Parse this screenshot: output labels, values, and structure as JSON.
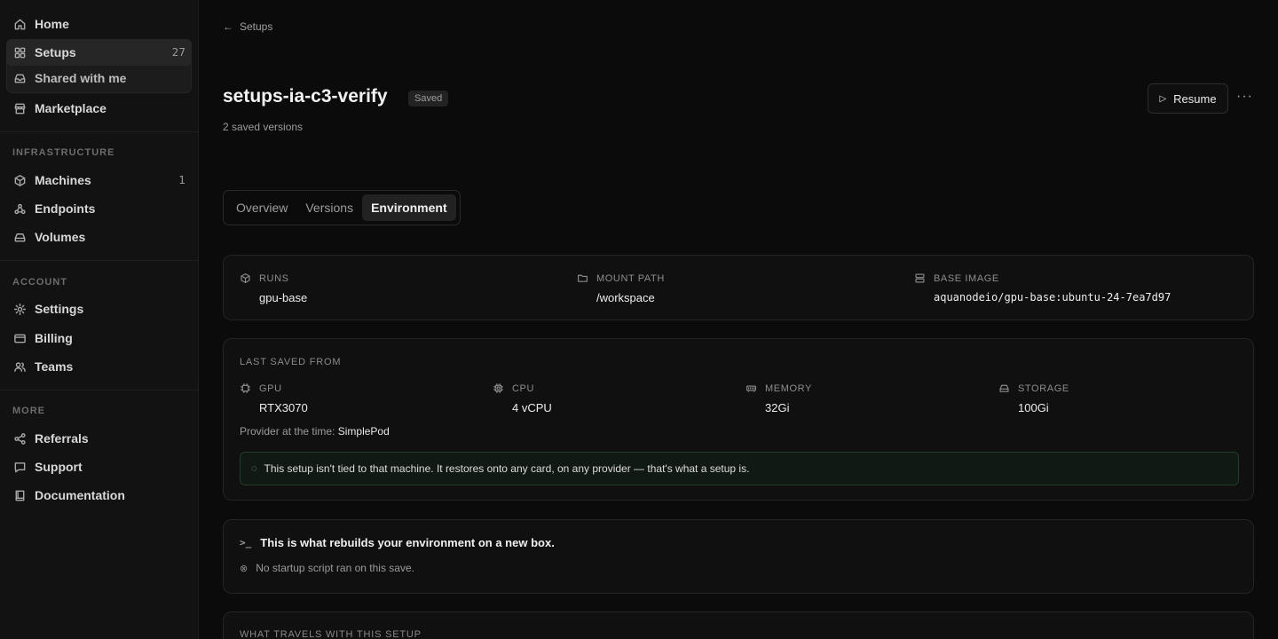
{
  "sidebar": {
    "home": "Home",
    "setups": "Setups",
    "setups_count": "27",
    "shared": "Shared with me",
    "marketplace": "Marketplace",
    "infra_header": "INFRASTRUCTURE",
    "machines": "Machines",
    "machines_count": "1",
    "endpoints": "Endpoints",
    "volumes": "Volumes",
    "account_header": "ACCOUNT",
    "settings": "Settings",
    "billing": "Billing",
    "teams": "Teams",
    "more_header": "MORE",
    "referrals": "Referrals",
    "support": "Support",
    "documentation": "Documentation"
  },
  "header": {
    "back_label": "Setups",
    "title": "setups-ia-c3-verify",
    "badge": "Saved",
    "subtitle": "2 saved versions",
    "resume_label": "Resume",
    "more_label": "···"
  },
  "tabs": [
    {
      "label": "Overview"
    },
    {
      "label": "Versions"
    },
    {
      "label": "Environment"
    }
  ],
  "runtime": {
    "runs_label": "RUNS",
    "runs_value": "gpu-base",
    "mount_label": "MOUNT PATH",
    "mount_value": "/workspace",
    "image_label": "BASE IMAGE",
    "image_value": "aquanodeio/gpu-base:ubuntu-24-7ea7d97"
  },
  "last_saved": {
    "header": "LAST SAVED FROM",
    "gpu_label": "GPU",
    "gpu_value": "RTX3070",
    "cpu_label": "CPU",
    "cpu_value": "4 vCPU",
    "memory_label": "MEMORY",
    "memory_value": "32Gi",
    "storage_label": "STORAGE",
    "storage_value": "100Gi",
    "provider_prefix": "Provider at the time:",
    "provider_value": "SimplePod",
    "note": "This setup isn't tied to that machine. It restores onto any card, on any provider — that's what a setup is."
  },
  "startup": {
    "title": "This is what rebuilds your environment on a new box.",
    "status": "No startup script ran on this save."
  },
  "travels": {
    "header": "WHAT TRAVELS WITH THIS SETUP"
  },
  "colors": {
    "background": "#0b0b0b",
    "sidebar": "#121212",
    "note_border": "#21402c"
  }
}
